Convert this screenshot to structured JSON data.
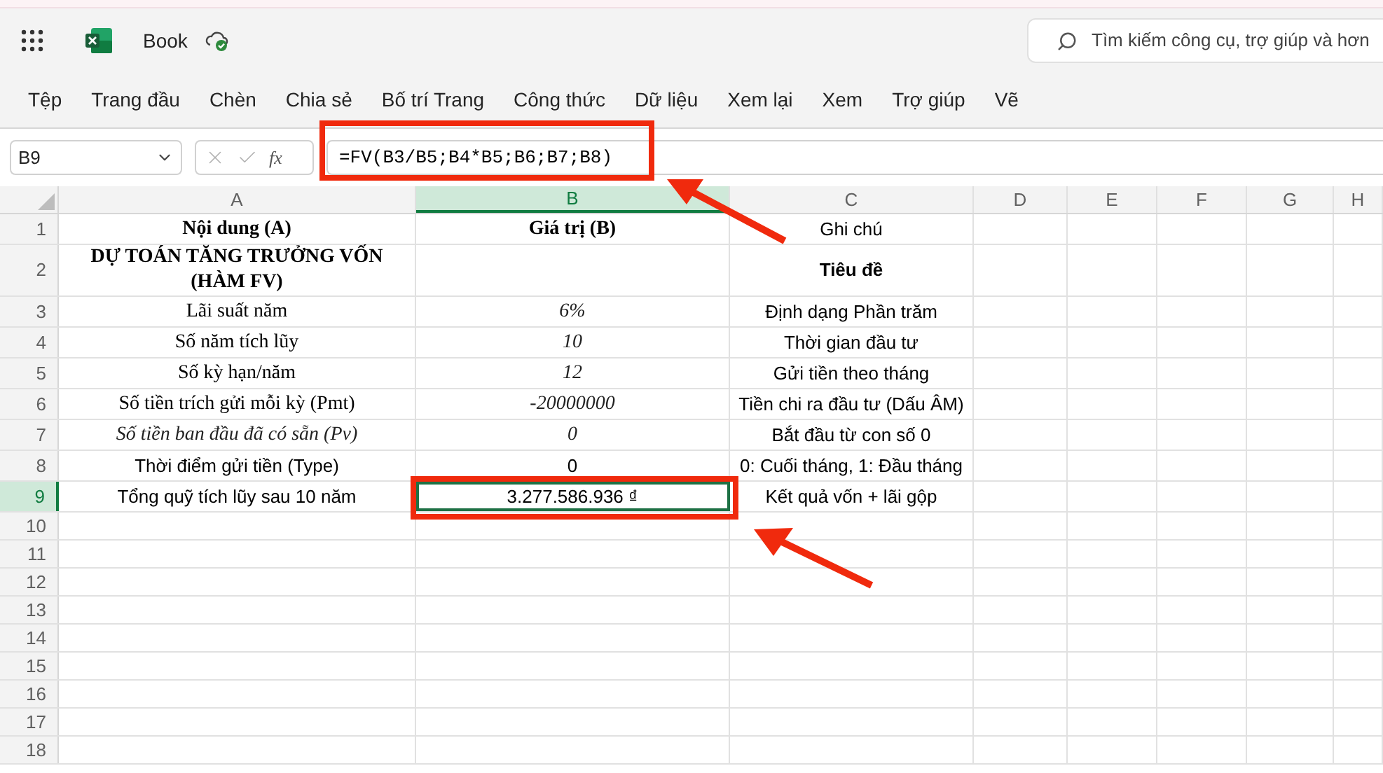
{
  "app": {
    "title": "Book",
    "search": {
      "placeholder": "Tìm kiếm công cụ, trợ giúp và hơn"
    }
  },
  "menu": [
    {
      "label": "Tệp",
      "selected": false
    },
    {
      "label": "Trang đầu",
      "selected": false
    },
    {
      "label": "Chèn",
      "selected": false
    },
    {
      "label": "Chia sẻ",
      "selected": false
    },
    {
      "label": "Bố trí Trang",
      "selected": false
    },
    {
      "label": "Công thức",
      "selected": false
    },
    {
      "label": "Dữ liệu",
      "selected": false
    },
    {
      "label": "Xem lại",
      "selected": false
    },
    {
      "label": "Xem",
      "selected": false
    },
    {
      "label": "Trợ giúp",
      "selected": false
    },
    {
      "label": "Vẽ",
      "selected": false
    }
  ],
  "formula_bar": {
    "name_box": "B9",
    "function_label": "fx",
    "formula": "=FV(B3/B5;B4*B5;B6;B7;B8)"
  },
  "columns": [
    {
      "label": "A",
      "selected": false
    },
    {
      "label": "B",
      "selected": true
    },
    {
      "label": "C",
      "selected": false
    },
    {
      "label": "D",
      "selected": false
    },
    {
      "label": "E",
      "selected": false
    },
    {
      "label": "F",
      "selected": false
    },
    {
      "label": "G",
      "selected": false
    },
    {
      "label": "H",
      "selected": false
    }
  ],
  "rows": [
    {
      "number": "1",
      "selected": false,
      "cells": [
        {
          "text": "Nội dung (A)",
          "kind": "header"
        },
        {
          "text": "Giá trị (B)",
          "kind": "header"
        },
        {
          "text": "Ghi chú",
          "kind": "plain"
        }
      ]
    },
    {
      "number": "2",
      "selected": false,
      "cells": [
        {
          "text": "DỰ TOÁN TĂNG TRƯỞNG VỐN (HÀM FV)",
          "kind": "header"
        },
        null,
        {
          "text": "Tiêu đề",
          "kind": "subheader"
        }
      ]
    },
    {
      "number": "3",
      "selected": false,
      "cells": [
        {
          "text": "Lãi suất năm",
          "kind": "text"
        },
        {
          "text": "6%",
          "kind": "input"
        },
        {
          "text": "Định dạng Phần trăm",
          "kind": "plain"
        }
      ]
    },
    {
      "number": "4",
      "selected": false,
      "cells": [
        {
          "text": "Số năm tích lũy",
          "kind": "text"
        },
        {
          "text": "10",
          "kind": "input"
        },
        {
          "text": "Thời gian đầu tư",
          "kind": "plain"
        }
      ]
    },
    {
      "number": "5",
      "selected": false,
      "cells": [
        {
          "text": "Số kỳ hạn/năm",
          "kind": "text"
        },
        {
          "text": "12",
          "kind": "input"
        },
        {
          "text": "Gửi tiền theo tháng",
          "kind": "plain"
        }
      ]
    },
    {
      "number": "6",
      "selected": false,
      "cells": [
        {
          "text": "Số tiền trích gửi mỗi kỳ (Pmt)",
          "kind": "text"
        },
        {
          "text": "-20000000",
          "kind": "input"
        },
        {
          "text": "Tiền chi ra đầu tư (Dấu ÂM)",
          "kind": "plain"
        }
      ]
    },
    {
      "number": "7",
      "selected": false,
      "cells": [
        {
          "text": "Số tiền ban đầu đã có sẵn (Pv)",
          "kind": "input"
        },
        {
          "text": "0",
          "kind": "input"
        },
        {
          "text": "Bắt đầu từ con số 0",
          "kind": "plain"
        }
      ]
    },
    {
      "number": "8",
      "selected": false,
      "cells": [
        {
          "text": "Thời điểm gửi tiền (Type)",
          "kind": "plain"
        },
        {
          "text": "0",
          "kind": "plain"
        },
        {
          "text": "0: Cuối tháng, 1: Đầu tháng",
          "kind": "plain"
        }
      ]
    },
    {
      "number": "9",
      "selected": true,
      "cells": [
        {
          "text": "Tổng quỹ tích lũy sau 10 năm",
          "kind": "plain"
        },
        {
          "text": "3.277.586.936 ₫",
          "kind": "plain",
          "selected": true
        },
        {
          "text": "Kết quả vốn + lãi gộp",
          "kind": "plain"
        }
      ]
    },
    {
      "number": "10",
      "selected": false
    },
    {
      "number": "11",
      "selected": false
    },
    {
      "number": "12",
      "selected": false
    },
    {
      "number": "13",
      "selected": false
    },
    {
      "number": "14",
      "selected": false
    },
    {
      "number": "15",
      "selected": false
    },
    {
      "number": "16",
      "selected": false
    },
    {
      "number": "17",
      "selected": false
    },
    {
      "number": "18",
      "selected": false
    }
  ]
}
